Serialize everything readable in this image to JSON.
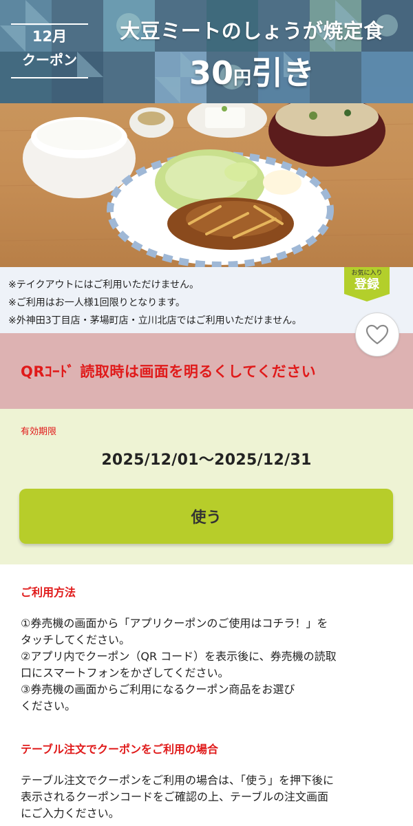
{
  "banner": {
    "badge_month": "12月",
    "badge_label": "クーポン",
    "title": "大豆ミートのしょうが焼定食",
    "discount_number": "30",
    "discount_unit": "円",
    "discount_suffix": "引き"
  },
  "notes": [
    "※テイクアウトにはご利用いただけません。",
    "※ご利用はお一人様1回限りとなります。",
    "※外神田3丁目店・茅場町店・立川北店ではご利用いただけません。"
  ],
  "favorite": {
    "small": "お気に入り",
    "big": "登録",
    "icon": "heart-icon"
  },
  "warning": "QRｺｰﾄﾞ 読取時は画面を明るくしてください",
  "validity": {
    "label": "有効期限",
    "dates": "2025/12/01～2025/12/31"
  },
  "use_button": "使う",
  "howto": {
    "title": "ご利用方法",
    "steps": [
      "①券売機の画面から「アプリクーポンのご使用はコチラ！」を",
      "タッチしてください。",
      "②アプリ内でクーポン（QR コード）を表示後に、券売機の読取",
      "口にスマートフォンをかざしてください。",
      "③券売機の画面からご利用になるクーポン商品をお選び",
      "ください。"
    ],
    "table_title": "テーブル注文でクーポンをご利用の場合",
    "table_lines": [
      "テーブル注文でクーポンをご利用の場合は、「使う」を押下後に",
      "表示されるクーポンコードをご確認の上、テーブルの注文画面",
      "にご入力ください。"
    ]
  },
  "colors": {
    "banner_bg": "#4e6f86",
    "warning_bg": "#ddb2b2",
    "warning_text": "#e01a1a",
    "validity_bg": "#eef3d4",
    "use_button": "#b7cd2a",
    "accent_red": "#e01a1a"
  }
}
